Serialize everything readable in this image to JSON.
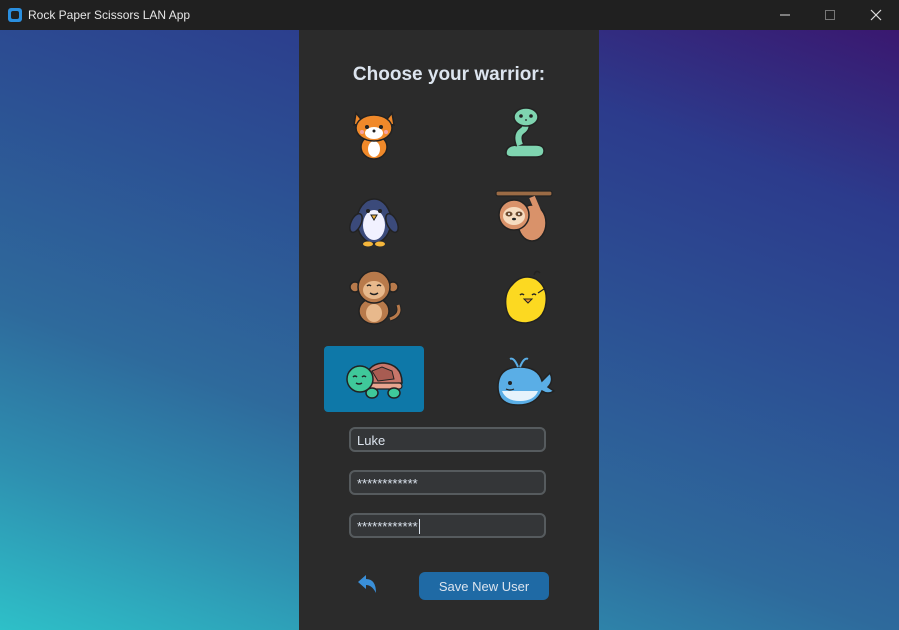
{
  "window": {
    "title": "Rock Paper Scissors LAN App"
  },
  "form": {
    "heading": "Choose your warrior:",
    "avatars": [
      {
        "name": "fox",
        "selected": false
      },
      {
        "name": "snake",
        "selected": false
      },
      {
        "name": "penguin",
        "selected": false
      },
      {
        "name": "sloth",
        "selected": false
      },
      {
        "name": "monkey",
        "selected": false
      },
      {
        "name": "chick",
        "selected": false
      },
      {
        "name": "turtle",
        "selected": true
      },
      {
        "name": "whale",
        "selected": false
      }
    ],
    "username_value": "Luke",
    "password_value": "************",
    "confirm_password_value": "************",
    "back_icon": "back-arrow-icon",
    "save_label": "Save New User"
  },
  "colors": {
    "panel": "#2b2b2b",
    "selected_tile": "#0e78a8",
    "button": "#1f6aa5",
    "back_arrow": "#3a8fd8"
  }
}
